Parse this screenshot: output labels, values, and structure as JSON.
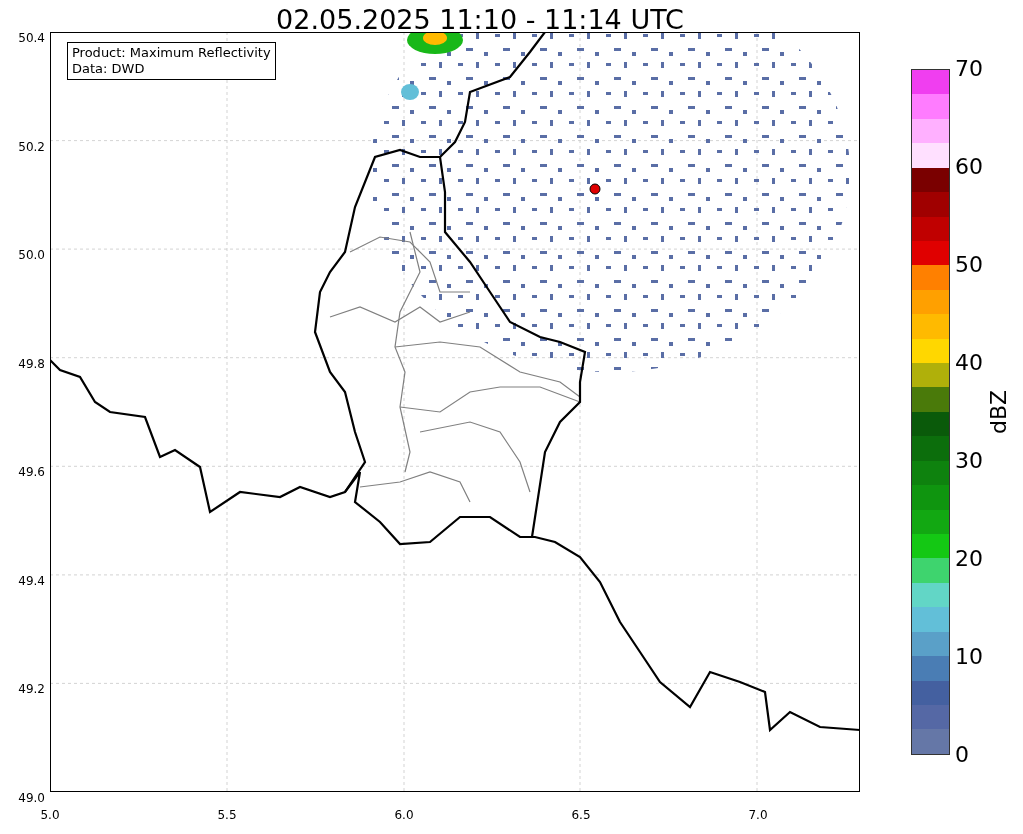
{
  "title": "02.05.2025 11:10 - 11:14 UTC",
  "legend": [
    "Product: Maximum Reflectivity",
    "Data: DWD"
  ],
  "y_ticks": [
    "50.4",
    "50.2",
    "50.0",
    "49.8",
    "49.6",
    "49.4",
    "49.2",
    "49.0"
  ],
  "x_ticks": [
    "5.0",
    "5.5",
    "6.0",
    "6.5",
    "7.0"
  ],
  "colorbar": {
    "label": "dBZ",
    "ticks": [
      "70",
      "60",
      "50",
      "40",
      "30",
      "20",
      "10",
      "0"
    ],
    "segments": [
      {
        "color": "#f03ef0"
      },
      {
        "color": "#ff7cff"
      },
      {
        "color": "#ffb0ff"
      },
      {
        "color": "#ffe0ff"
      },
      {
        "color": "#7a0000"
      },
      {
        "color": "#a00000"
      },
      {
        "color": "#c00000"
      },
      {
        "color": "#e00000"
      },
      {
        "color": "#ff8000"
      },
      {
        "color": "#ffa000"
      },
      {
        "color": "#ffba00"
      },
      {
        "color": "#ffd700"
      },
      {
        "color": "#b0b00a"
      },
      {
        "color": "#4a7a0a"
      },
      {
        "color": "#0a5a0a"
      },
      {
        "color": "#0c6e0c"
      },
      {
        "color": "#0e820e"
      },
      {
        "color": "#0f950f"
      },
      {
        "color": "#12a812"
      },
      {
        "color": "#14c814"
      },
      {
        "color": "#3ed46e"
      },
      {
        "color": "#62d6c6"
      },
      {
        "color": "#62bfd8"
      },
      {
        "color": "#5aa0c8"
      },
      {
        "color": "#4a7db4"
      },
      {
        "color": "#4460a0"
      },
      {
        "color": "#5568a5"
      },
      {
        "color": "#6577a7"
      }
    ]
  }
}
